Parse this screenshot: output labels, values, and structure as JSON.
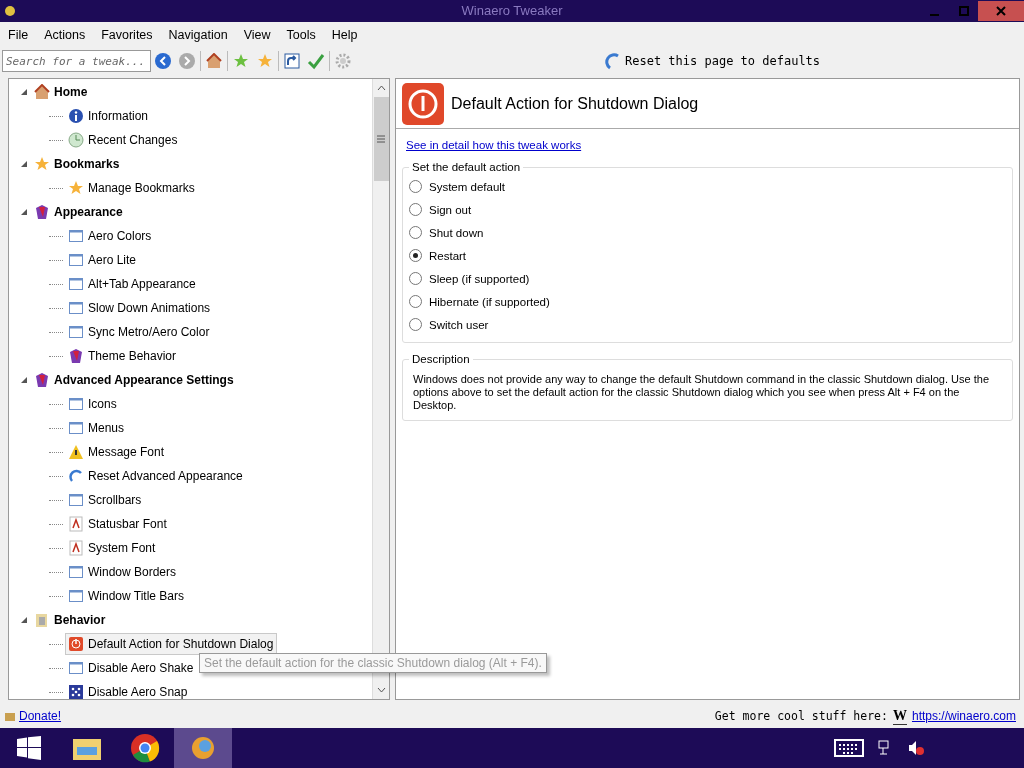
{
  "window": {
    "title": "Winaero Tweaker"
  },
  "menu": [
    "File",
    "Actions",
    "Favorites",
    "Navigation",
    "View",
    "Tools",
    "Help"
  ],
  "toolbar": {
    "search": {
      "placeholder": "Search for a tweak..."
    },
    "reset": "Reset this page to defaults"
  },
  "tree": [
    {
      "label": "Home",
      "expanded": true,
      "children": [
        {
          "label": "Information",
          "selected": false
        },
        {
          "label": "Recent Changes",
          "selected": false
        }
      ]
    },
    {
      "label": "Bookmarks",
      "expanded": true,
      "children": [
        {
          "label": "Manage Bookmarks",
          "selected": false
        }
      ]
    },
    {
      "label": "Appearance",
      "expanded": true,
      "children": [
        {
          "label": "Aero Colors",
          "selected": false
        },
        {
          "label": "Aero Lite",
          "selected": false
        },
        {
          "label": "Alt+Tab Appearance",
          "selected": false
        },
        {
          "label": "Slow Down Animations",
          "selected": false
        },
        {
          "label": "Sync Metro/Aero Color",
          "selected": false
        },
        {
          "label": "Theme Behavior",
          "selected": false
        }
      ]
    },
    {
      "label": "Advanced Appearance Settings",
      "expanded": true,
      "children": [
        {
          "label": "Icons",
          "selected": false
        },
        {
          "label": "Menus",
          "selected": false
        },
        {
          "label": "Message Font",
          "selected": false
        },
        {
          "label": "Reset Advanced Appearance",
          "selected": false
        },
        {
          "label": "Scrollbars",
          "selected": false
        },
        {
          "label": "Statusbar Font",
          "selected": false
        },
        {
          "label": "System Font",
          "selected": false
        },
        {
          "label": "Window Borders",
          "selected": false
        },
        {
          "label": "Window Title Bars",
          "selected": false
        }
      ]
    },
    {
      "label": "Behavior",
      "expanded": true,
      "children": [
        {
          "label": "Default Action for Shutdown Dialog",
          "selected": true
        },
        {
          "label": "Disable Aero Shake",
          "selected": false
        },
        {
          "label": "Disable Aero Snap",
          "selected": false
        }
      ]
    }
  ],
  "tooltip": "Set the default action for the classic Shutdown dialog (Alt + F4).",
  "page": {
    "title": "Default Action for Shutdown Dialog",
    "link": "See in detail how this tweak works",
    "group": {
      "title": "Set the default action",
      "options": [
        {
          "label": "System default",
          "selected": false
        },
        {
          "label": "Sign out",
          "selected": false
        },
        {
          "label": "Shut down",
          "selected": false
        },
        {
          "label": "Restart",
          "selected": true
        },
        {
          "label": "Sleep (if supported)",
          "selected": false
        },
        {
          "label": "Hibernate (if supported)",
          "selected": false
        },
        {
          "label": "Switch user",
          "selected": false
        }
      ]
    },
    "description": {
      "title": "Description",
      "text": "Windows does not provide any way to change the default Shutdown command in the classic Shutdown dialog. Use the options above to set the default action for the classic Shutdown dialog which you see when press Alt + F4 on the Desktop."
    }
  },
  "status_bar": {
    "donate": "Donate!",
    "more": "Get more cool stuff here:",
    "logo": "W",
    "url": "https://winaero.com"
  }
}
